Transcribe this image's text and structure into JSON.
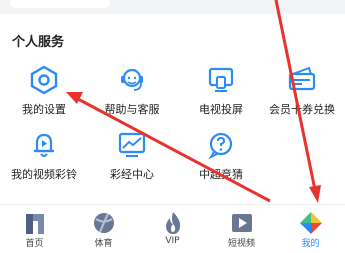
{
  "section": {
    "title": "个人服务"
  },
  "services": [
    {
      "label": "我的设置",
      "icon": "settings-gear-icon"
    },
    {
      "label": "帮助与客服",
      "icon": "headset-service-icon"
    },
    {
      "label": "电视投屏",
      "icon": "tv-cast-icon"
    },
    {
      "label": "会员卡券兑换",
      "icon": "ticket-card-icon"
    },
    {
      "label": "我的视频彩铃",
      "icon": "bell-ringtone-icon"
    },
    {
      "label": "彩经中心",
      "icon": "trend-chart-icon"
    },
    {
      "label": "中超竞猜",
      "icon": "question-bubble-icon"
    }
  ],
  "tabs": [
    {
      "label": "首页",
      "icon": "home-logo-icon"
    },
    {
      "label": "体育",
      "icon": "sports-ball-icon"
    },
    {
      "label": "VIP",
      "icon": "vip-flame-icon"
    },
    {
      "label": "短视频",
      "icon": "short-video-play-icon"
    },
    {
      "label": "我的",
      "icon": "mine-prism-icon",
      "active": true
    }
  ],
  "colors": {
    "icon_blue": "#2b8cf7",
    "arrow_red": "#e8322e",
    "active_tab": "#2b8cf7"
  }
}
